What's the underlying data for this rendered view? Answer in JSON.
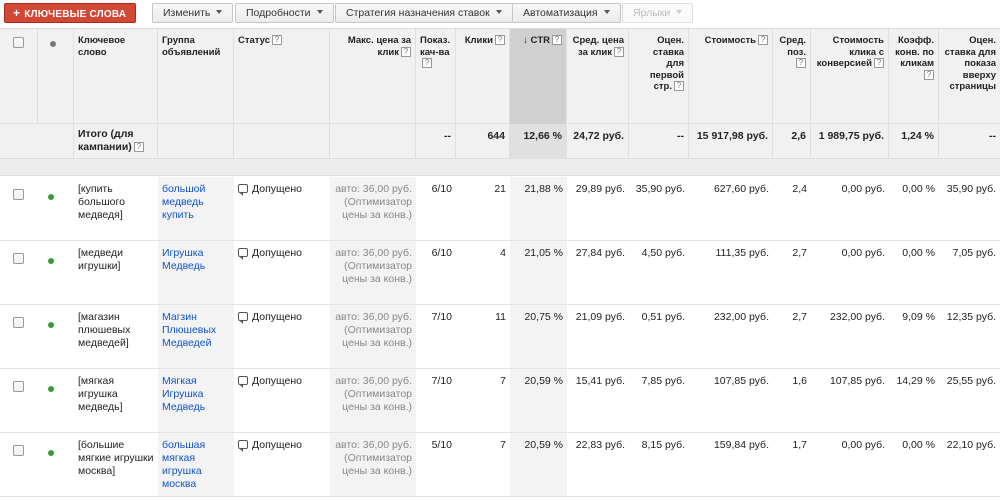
{
  "toolbar": {
    "add_keywords": "КЛЮЧЕВЫЕ СЛОВА",
    "edit": "Изменить",
    "details": "Подробности",
    "bid_strategy": "Стратегия назначения ставок",
    "automation": "Автоматизация",
    "labels": "Ярлыки"
  },
  "columns": {
    "keyword": "Ключевое слово",
    "adgroup": "Группа объявлений",
    "status": "Статус",
    "max_cpc": "Макс. цена за клик",
    "quality": "Показ. кач-ва",
    "clicks": "Клики",
    "ctr": "CTR",
    "avg_cpc": "Сред. цена за клик",
    "first_page_bid": "Оцен. ставка для первой стр.",
    "cost": "Стоимость",
    "avg_pos": "Сред. поз.",
    "cost_per_conv": "Стоимость клика с конверсией",
    "conv_rate": "Коэфф. конв. по кликам",
    "top_page_bid": "Оцен. ставка для показа вверху страницы",
    "help_glyph": "?",
    "sort_arrow": "↓"
  },
  "total": {
    "label": "Итого (для кампании)",
    "quality": "--",
    "clicks": "644",
    "ctr": "12,66 %",
    "avg_cpc": "24,72 руб.",
    "first_page_bid": "--",
    "cost": "15 917,98 руб.",
    "avg_pos": "2,6",
    "cost_per_conv": "1 989,75 руб.",
    "conv_rate": "1,24 %",
    "top_page_bid": "--"
  },
  "rows": [
    {
      "keyword": "[купить большого медведя]",
      "adgroup": "большой медведь купить",
      "status": "Допущено",
      "max_cpc": "авто: 36,00 руб. (Оптимизатор цены за конв.)",
      "quality": "6/10",
      "clicks": "21",
      "ctr": "21,88 %",
      "avg_cpc": "29,89 руб.",
      "first_page_bid": "35,90 руб.",
      "cost": "627,60 руб.",
      "avg_pos": "2,4",
      "cost_per_conv": "0,00 руб.",
      "conv_rate": "0,00 %",
      "top_page_bid": "35,90 руб."
    },
    {
      "keyword": "[медведи игрушки]",
      "adgroup": "Игрушка Медведь",
      "status": "Допущено",
      "max_cpc": "авто: 36,00 руб. (Оптимизатор цены за конв.)",
      "quality": "6/10",
      "clicks": "4",
      "ctr": "21,05 %",
      "avg_cpc": "27,84 руб.",
      "first_page_bid": "4,50 руб.",
      "cost": "111,35 руб.",
      "avg_pos": "2,7",
      "cost_per_conv": "0,00 руб.",
      "conv_rate": "0,00 %",
      "top_page_bid": "7,05 руб."
    },
    {
      "keyword": "[магазин плюшевых медведей]",
      "adgroup": "Магзин Плюшевых Медведей",
      "status": "Допущено",
      "max_cpc": "авто: 36,00 руб. (Оптимизатор цены за конв.)",
      "quality": "7/10",
      "clicks": "11",
      "ctr": "20,75 %",
      "avg_cpc": "21,09 руб.",
      "first_page_bid": "0,51 руб.",
      "cost": "232,00 руб.",
      "avg_pos": "2,7",
      "cost_per_conv": "232,00 руб.",
      "conv_rate": "9,09 %",
      "top_page_bid": "12,35 руб."
    },
    {
      "keyword": "[мягкая игрушка медведь]",
      "adgroup": "Мягкая Игрушка Медведь",
      "status": "Допущено",
      "max_cpc": "авто: 36,00 руб. (Оптимизатор цены за конв.)",
      "quality": "7/10",
      "clicks": "7",
      "ctr": "20,59 %",
      "avg_cpc": "15,41 руб.",
      "first_page_bid": "7,85 руб.",
      "cost": "107,85 руб.",
      "avg_pos": "1,6",
      "cost_per_conv": "107,85 руб.",
      "conv_rate": "14,29 %",
      "top_page_bid": "25,55 руб."
    },
    {
      "keyword": "[большие мягкие игрушки москва]",
      "adgroup": "большая мягкая игрушка москва",
      "status": "Допущено",
      "max_cpc": "авто: 36,00 руб. (Оптимизатор цены за конв.)",
      "quality": "5/10",
      "clicks": "7",
      "ctr": "20,59 %",
      "avg_cpc": "22,83 руб.",
      "first_page_bid": "8,15 руб.",
      "cost": "159,84 руб.",
      "avg_pos": "1,7",
      "cost_per_conv": "0,00 руб.",
      "conv_rate": "0,00 %",
      "top_page_bid": "22,10 руб."
    }
  ]
}
